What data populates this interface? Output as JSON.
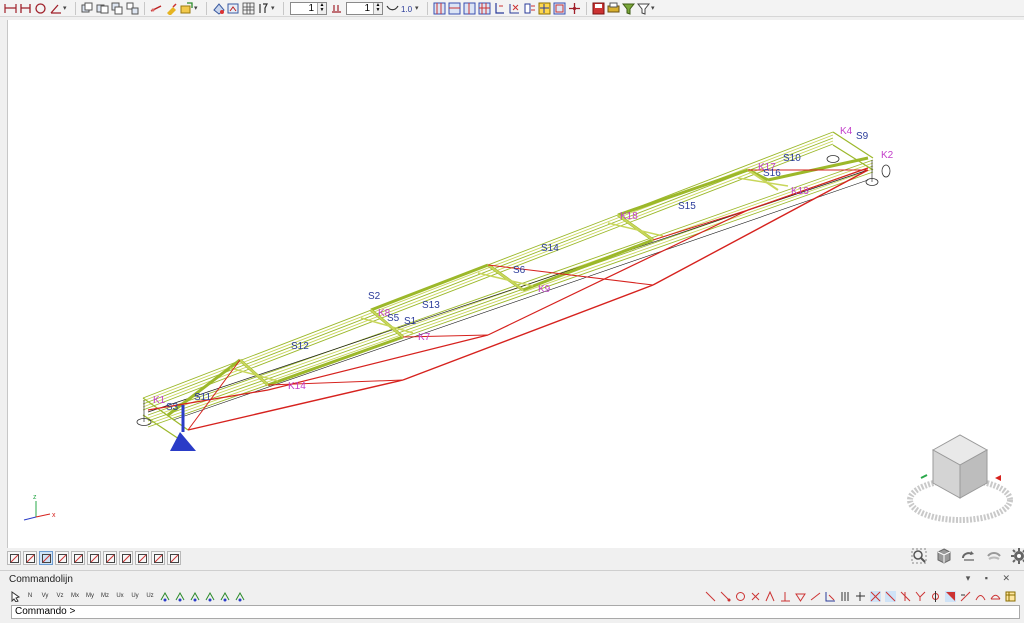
{
  "toolbar": {
    "spinner1_value": "1",
    "spinner2_value": "1",
    "buttons_group1": [
      "dimension-icon",
      "node-icon",
      "circle-icon",
      "angle-icon"
    ],
    "buttons_group2": [
      "copy-icon",
      "copy-right-icon",
      "copy-down-icon",
      "copy-stack-icon",
      "measure-icon",
      "paint-icon",
      "export-icon"
    ],
    "buttons_group3": [
      "render-icon",
      "render-view-icon",
      "grid-icon",
      "info-icon"
    ],
    "buttons_group4": [
      "mesh-icon",
      "mesh-left-icon",
      "mesh-right-icon",
      "mesh-grid-icon",
      "load-icon",
      "load-x-icon",
      "support-icon",
      "hinge-icon",
      "section-icon",
      "section-grid-icon",
      "move-icon",
      "save-icon",
      "print-icon",
      "filter-icon",
      "filter-down-icon"
    ]
  },
  "model": {
    "node_labels": [
      "K4",
      "K2",
      "K8",
      "K1",
      "K7",
      "K18",
      "K13",
      "K17",
      "K9",
      "K14"
    ],
    "member_labels": [
      "S9",
      "S10",
      "S16",
      "S15",
      "S14",
      "S6",
      "S2",
      "S5",
      "S1",
      "S13",
      "S12",
      "S3",
      "S11"
    ],
    "colors": {
      "truss_top": "#9cb82a",
      "truss_light": "#c8d65a",
      "bottom_chord": "#d6221e",
      "axis_line": "#1a1a1a",
      "support": "#2a3cc7",
      "node_label": "#c23ec9",
      "member_label": "#2a3b9a"
    }
  },
  "view_cube": {
    "label": "view-cube"
  },
  "view_modes": [
    {
      "icon": "pencil-icon",
      "active": false
    },
    {
      "icon": "eraser-icon",
      "active": false
    },
    {
      "icon": "person-icon",
      "active": true
    },
    {
      "icon": "chart-icon",
      "active": false
    },
    {
      "icon": "hierarchy-icon",
      "active": false
    },
    {
      "icon": "structure-icon",
      "active": false
    },
    {
      "icon": "section-view-icon",
      "active": false
    },
    {
      "icon": "pattern-icon",
      "active": false
    },
    {
      "icon": "book-icon",
      "active": false
    },
    {
      "icon": "calendar-icon",
      "active": false
    },
    {
      "icon": "grid-red-icon",
      "active": false
    }
  ],
  "command_panel": {
    "title": "Commandolijn",
    "window_controls": "▾ ▪ ✕",
    "prompt": "Commando >",
    "left_tools": [
      "N",
      "Vy",
      "Vz",
      "Mx",
      "My",
      "Mz",
      "Ux",
      "Uy",
      "Uz"
    ]
  }
}
